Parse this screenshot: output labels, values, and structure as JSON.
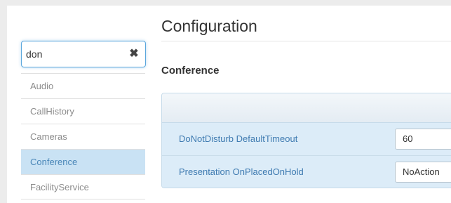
{
  "search": {
    "value": "don",
    "clear_glyph": "✖"
  },
  "sidebar": {
    "items": [
      {
        "label": "Audio",
        "active": false
      },
      {
        "label": "CallHistory",
        "active": false
      },
      {
        "label": "Cameras",
        "active": false
      },
      {
        "label": "Conference",
        "active": true
      },
      {
        "label": "FacilityService",
        "active": false
      }
    ]
  },
  "main": {
    "title": "Configuration",
    "section": "Conference",
    "settings": [
      {
        "label": "DoNotDisturb DefaultTimeout",
        "value": "60"
      },
      {
        "label": "Presentation OnPlacedOnHold",
        "value": "NoAction"
      }
    ]
  },
  "colors": {
    "accent": "#5ba7dd",
    "active_bg": "#c9e2f4",
    "row_bg": "#dcecf8",
    "link_text": "#3f7bb1"
  }
}
